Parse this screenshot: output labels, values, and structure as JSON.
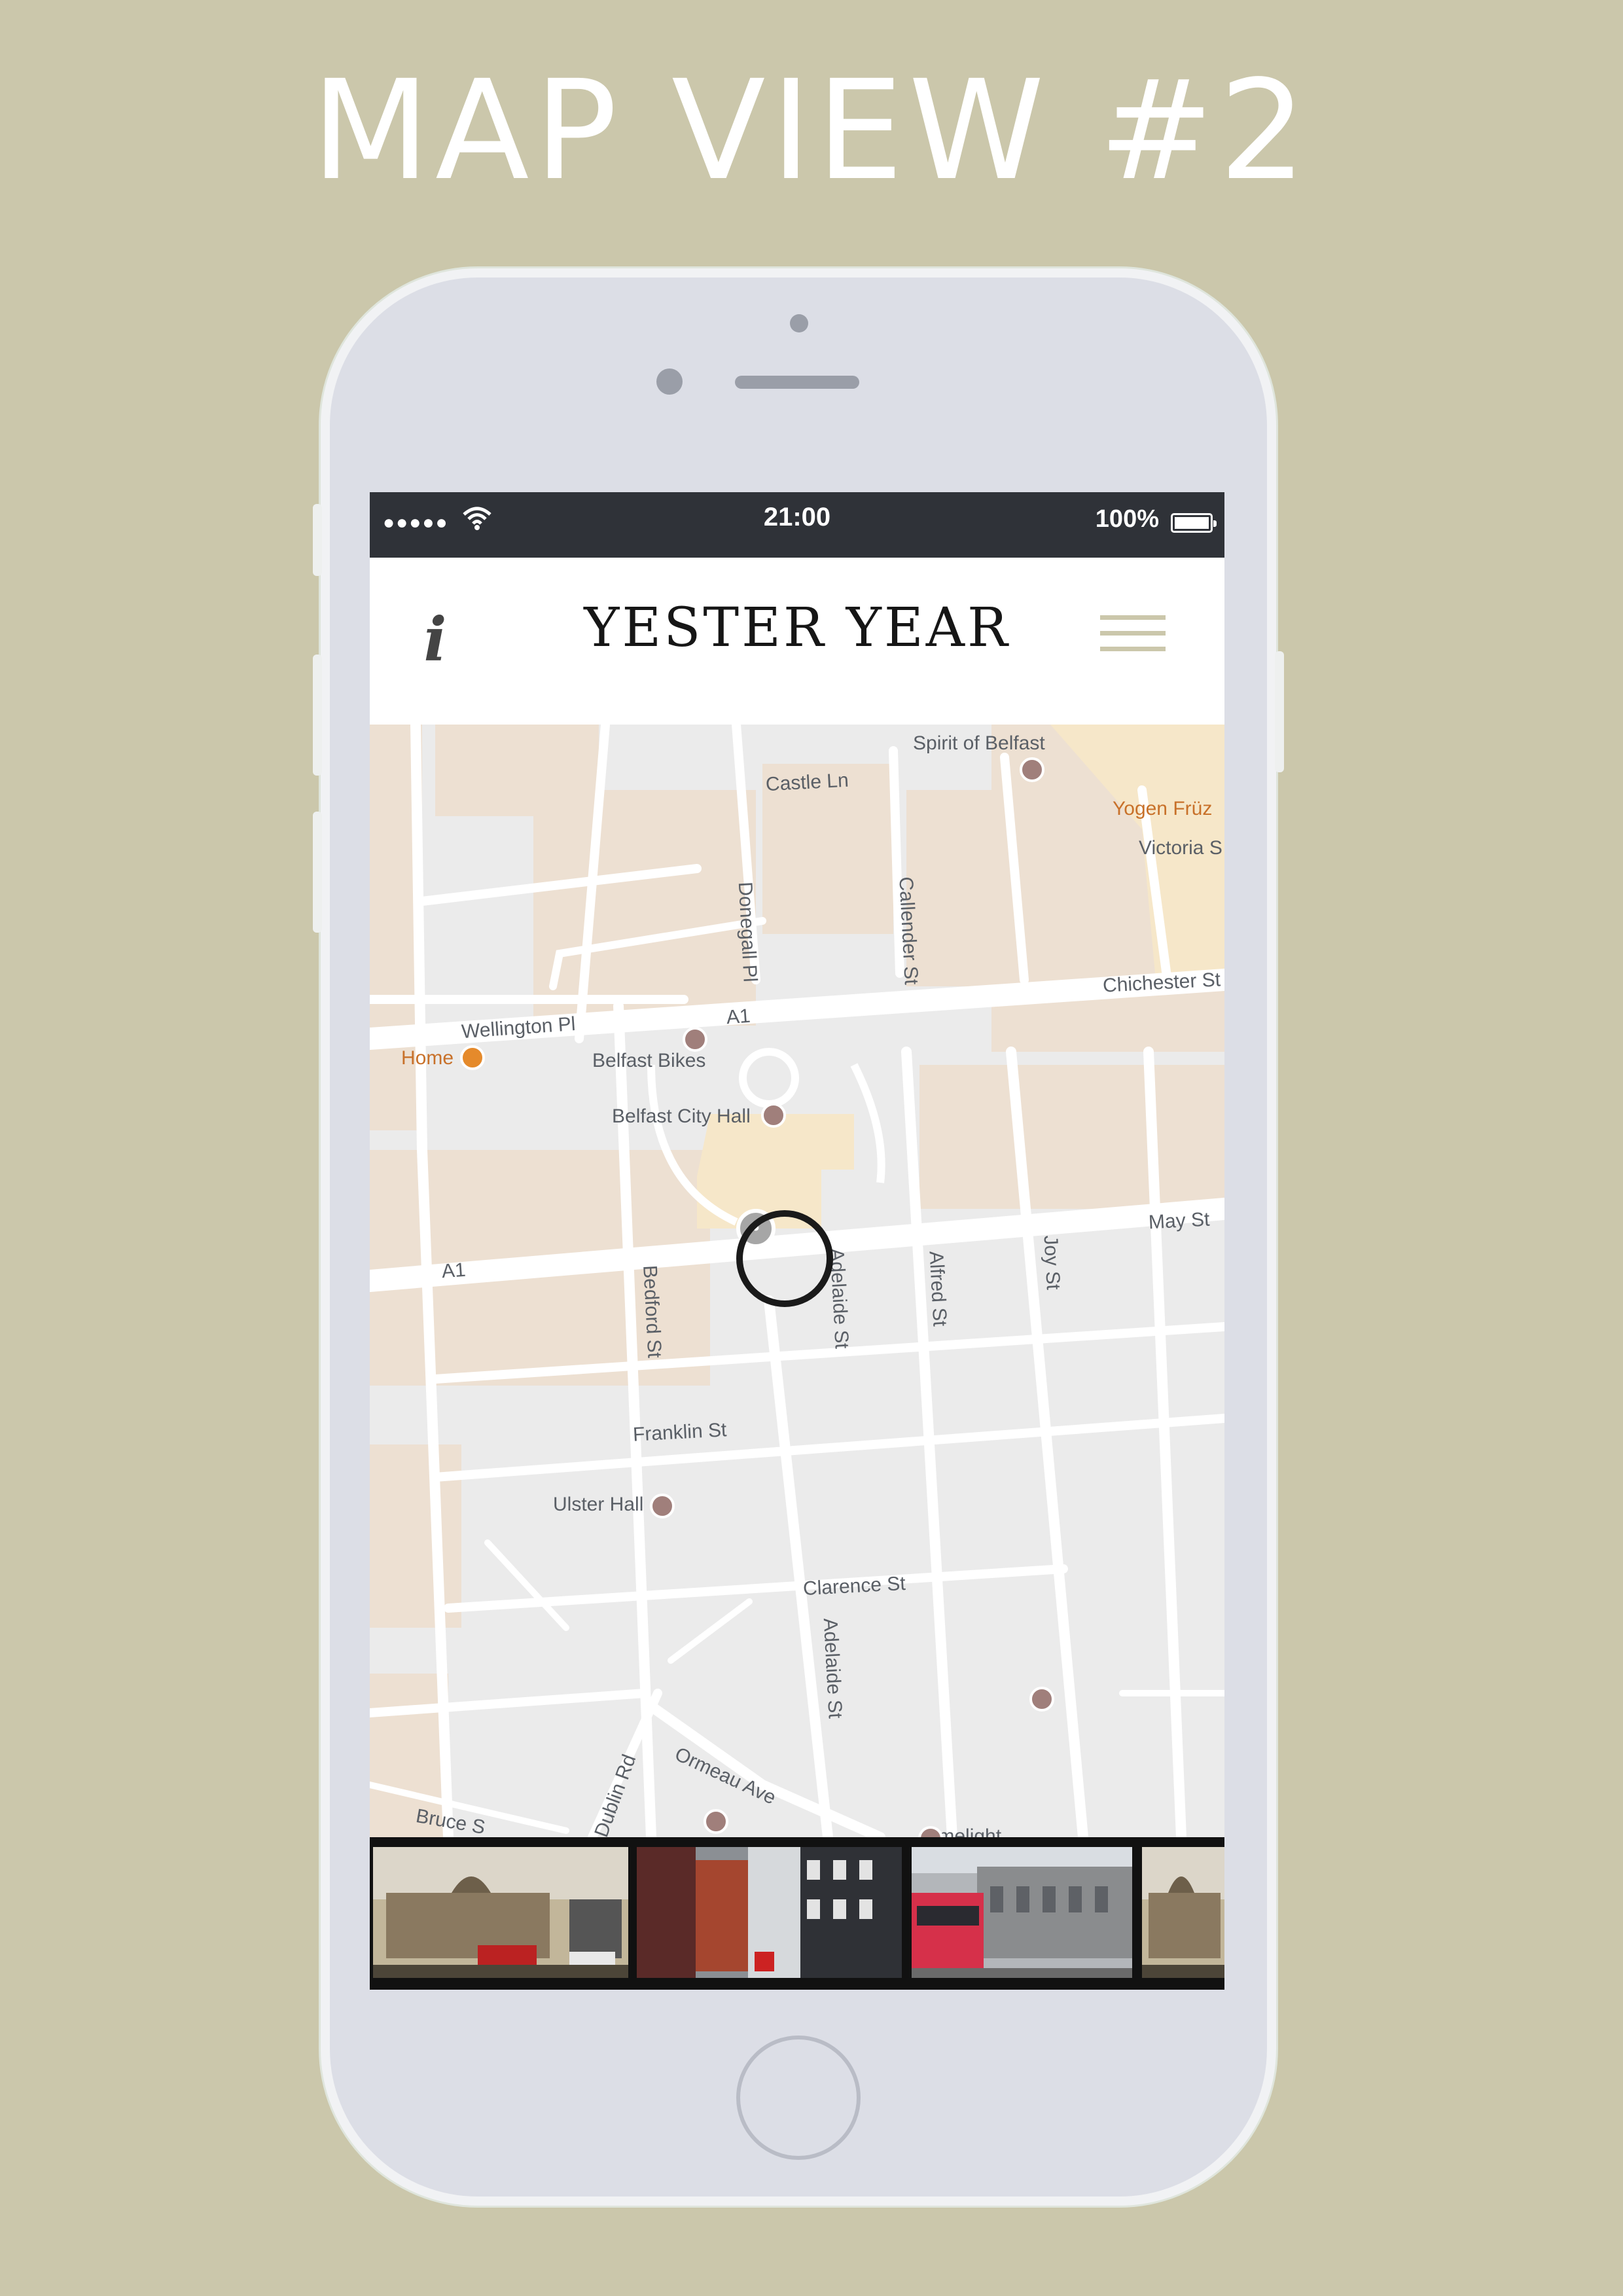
{
  "page": {
    "title": "MAP VIEW #2"
  },
  "status_bar": {
    "signal": "●●●●●",
    "time": "21:00",
    "battery": "100%"
  },
  "app_bar": {
    "logo": "YESTER YEAR",
    "info_label": "i"
  },
  "map": {
    "streets": [
      "Spirit of Belfast",
      "Castle Ln",
      "Yogen Früz",
      "Victoria S",
      "Donegall Pl",
      "Callender St",
      "Chichester St",
      "Wellington Pl",
      "A1",
      "Home",
      "Belfast Bikes",
      "Belfast City Hall",
      "May St",
      "A1",
      "Bedford St",
      "Adelaide St",
      "Alfred St",
      "Joy St",
      "Franklin St",
      "Ulster Hall",
      "Clarence St",
      "Adelaide St",
      "Dublin Rd",
      "Ormeau Ave",
      "Bruce S",
      "Limelight"
    ]
  },
  "thumbnails": [
    {
      "name": "city-hall-sepia"
    },
    {
      "name": "donegall-place-street"
    },
    {
      "name": "bus-street-scene"
    },
    {
      "name": "city-hall-sepia-2"
    }
  ],
  "colors": {
    "background": "#cbc7ab",
    "statusbar": "#2f3238",
    "accent": "#cbc7ab",
    "map_land": "#ebebeb",
    "map_block": "#ede0d2",
    "map_road": "#ffffff"
  }
}
